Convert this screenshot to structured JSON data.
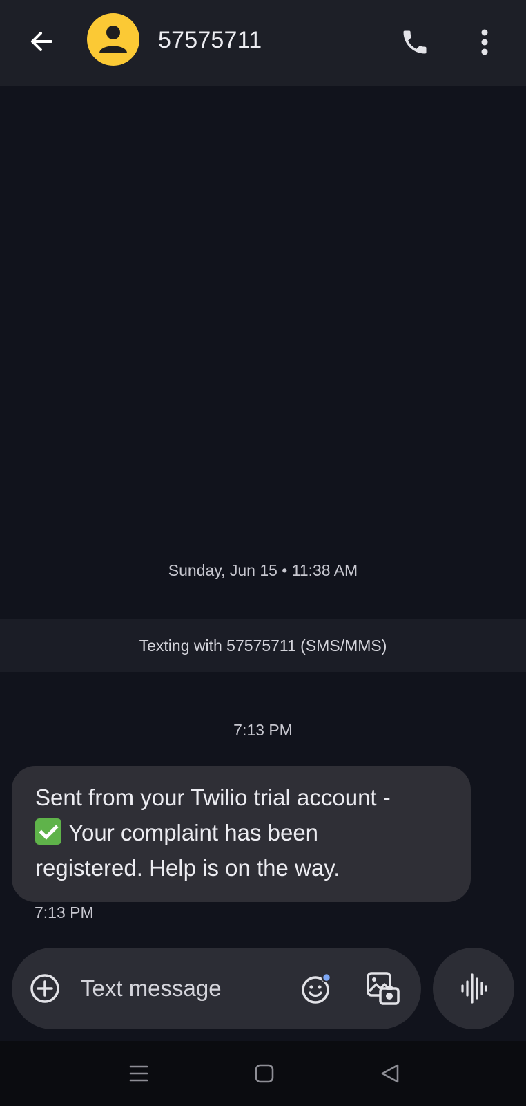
{
  "header": {
    "back_icon": "arrow-left-icon",
    "avatar_icon": "person-icon",
    "avatar_color": "#fbc935",
    "contact_name": "57575711",
    "call_icon": "phone-icon",
    "more_icon": "more-vertical-icon"
  },
  "conversation": {
    "date_stamp": "Sunday, Jun 15 • 11:38 AM",
    "info_band": "Texting with 57575711 (SMS/MMS)",
    "time_stamp": "7:13 PM",
    "message": {
      "line1": "Sent from your Twilio trial account -",
      "emoji": "check-mark-button-emoji",
      "line2": "Your complaint has been",
      "line3": "registered. Help is on the way.",
      "time": "7:13 PM"
    }
  },
  "compose": {
    "add_icon": "plus-circle-icon",
    "placeholder": "Text message",
    "emoji_icon": "emoji-icon",
    "gallery_icon": "gallery-icon",
    "voice_icon": "voice-waveform-icon"
  },
  "navbar": {
    "recents_icon": "recents-icon",
    "home_icon": "home-icon",
    "back_icon": "back-triangle-icon"
  },
  "colors": {
    "background": "#11131c",
    "header": "#1d1f27",
    "bubble": "#2f2f36",
    "compose": "#2c2d35",
    "navbar": "#0b0c10"
  }
}
